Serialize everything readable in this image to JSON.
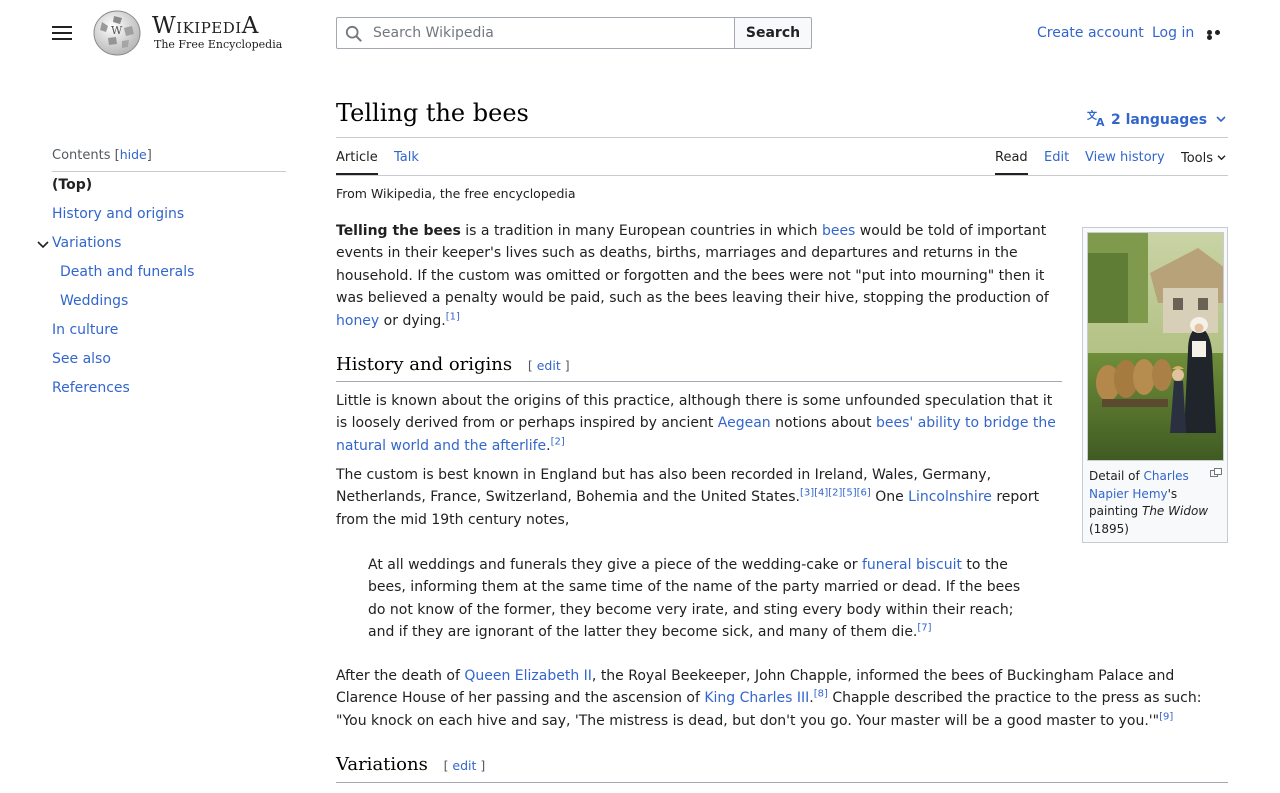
{
  "header": {
    "wordmark": "Wikipedia",
    "tagline": "The Free Encyclopedia",
    "search_placeholder": "Search Wikipedia",
    "search_button": "Search",
    "create_account": "Create account",
    "log_in": "Log in"
  },
  "toc": {
    "heading": "Contents",
    "hide_label": "hide",
    "items": [
      {
        "label": "(Top)"
      },
      {
        "label": "History and origins"
      },
      {
        "label": "Variations"
      },
      {
        "label": "Death and funerals"
      },
      {
        "label": "Weddings"
      },
      {
        "label": "In culture"
      },
      {
        "label": "See also"
      },
      {
        "label": "References"
      }
    ]
  },
  "article": {
    "title": "Telling the bees",
    "languages": "2 languages",
    "tabs": {
      "article": "Article",
      "talk": "Talk",
      "read": "Read",
      "edit": "Edit",
      "history": "View history",
      "tools": "Tools"
    },
    "from": "From Wikipedia, the free encyclopedia",
    "intro": {
      "bold": "Telling the bees",
      "t1": " is a tradition in many European countries in which ",
      "l1": "bees",
      "t2": " would be told of important events in their keeper's lives such as deaths, births, marriages and departures and returns in the household. If the custom was omitted or forgotten and the bees were not \"put into mourning\" then it was believed a penalty would be paid, such as the bees leaving their hive, stopping the production of ",
      "l2": "honey",
      "t3": " or dying.",
      "ref1": "[1]"
    },
    "sec1": {
      "heading": "History and origins",
      "edit": "edit",
      "p1_t1": "Little is known about the origins of this practice, although there is some unfounded speculation that it is loosely derived from or perhaps inspired by ancient ",
      "p1_l1": "Aegean",
      "p1_t2": " notions about ",
      "p1_l2": "bees' ability to bridge the natural world and the afterlife",
      "p1_t3": ".",
      "p1_ref": "[2]",
      "p2_t1": "The custom is best known in England but has also been recorded in Ireland, Wales, Germany, Netherlands, France, Switzerland, Bohemia and the United States.",
      "p2_refs": "[3][4][2][5][6]",
      "p2_t2": " One ",
      "p2_l1": "Lincolnshire",
      "p2_t3": " report from the mid 19th century notes,",
      "quote_t1": "At all weddings and funerals they give a piece of the wedding-cake or ",
      "quote_l1": "funeral biscuit",
      "quote_t2": " to the bees, informing them at the same time of the name of the party married or dead. If the bees do not know of the former, they become very irate, and sting every body within their reach; and if they are ignorant of the latter they become sick, and many of them die.",
      "quote_ref": "[7]",
      "p3_t1": "After the death of ",
      "p3_l1": "Queen Elizabeth II",
      "p3_t2": ", the Royal Beekeeper, John Chapple, informed the bees of Buckingham Palace and Clarence House of her passing and the ascension of ",
      "p3_l2": "King Charles III",
      "p3_t3": ".",
      "p3_ref1": "[8]",
      "p3_t4": " Chapple described the practice to the press as such: \"You knock on each hive and say, 'The mistress is dead, but don't you go. Your master will be a good master to you.'\"",
      "p3_ref2": "[9]"
    },
    "sec2": {
      "heading": "Variations",
      "edit": "edit"
    },
    "thumb": {
      "c1": "Detail of ",
      "l1": "Charles Napier Hemy",
      "c2": "'s painting ",
      "italic": "The Widow",
      "c3": " (1895)"
    }
  }
}
